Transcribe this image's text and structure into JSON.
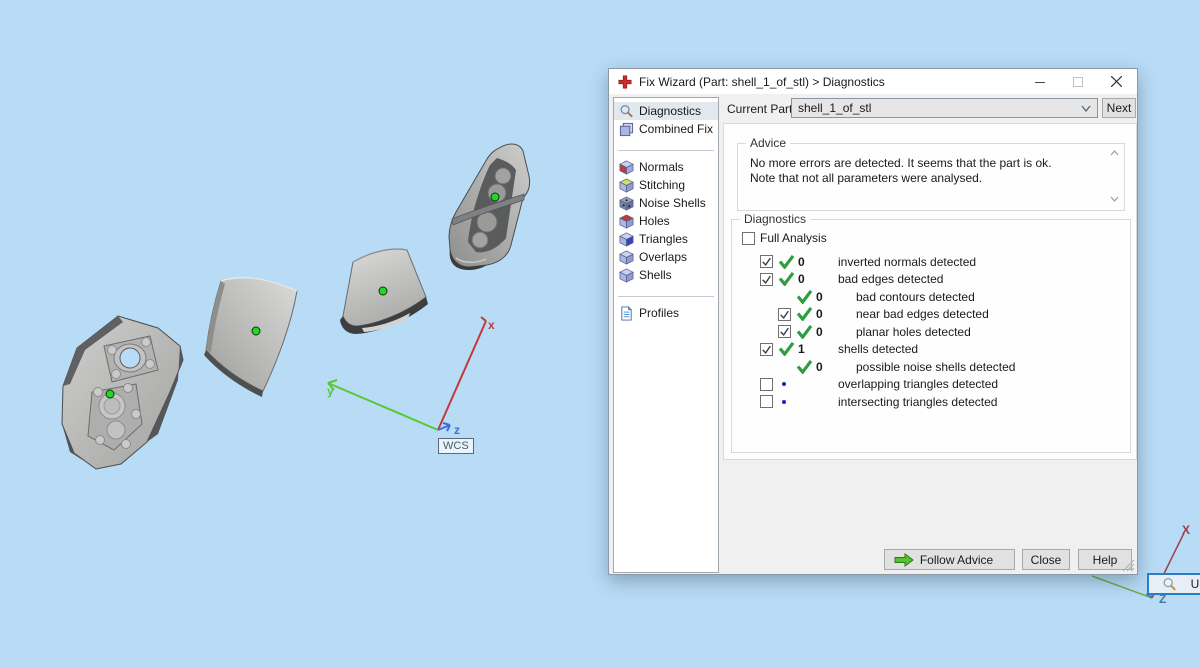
{
  "window": {
    "title": "Fix Wizard (Part: shell_1_of_stl) > Diagnostics",
    "app_icon": "red-cross-fix-wizard-icon",
    "controls": [
      "minimize",
      "maximize",
      "close"
    ]
  },
  "sidebar": {
    "sections": [
      {
        "items": [
          {
            "icon": "magnifier-icon",
            "label": "Diagnostics",
            "selected": true
          },
          {
            "icon": "combined-fix-cubes-icon",
            "label": "Combined Fix",
            "selected": false
          }
        ]
      },
      {
        "items": [
          {
            "icon": "cube-red-front-icon",
            "label": "Normals",
            "selected": false
          },
          {
            "icon": "cube-yellow-top-icon",
            "label": "Stitching",
            "selected": false
          },
          {
            "icon": "cube-dotted-icon",
            "label": "Noise Shells",
            "selected": false
          },
          {
            "icon": "cube-red-top-icon",
            "label": "Holes",
            "selected": false
          },
          {
            "icon": "cube-blue-face-icon",
            "label": "Triangles",
            "selected": false
          },
          {
            "icon": "cube-plain-icon",
            "label": "Overlaps",
            "selected": false
          },
          {
            "icon": "cube-plain-icon",
            "label": "Shells",
            "selected": false
          }
        ]
      },
      {
        "items": [
          {
            "icon": "document-icon",
            "label": "Profiles",
            "selected": false
          }
        ]
      }
    ]
  },
  "toolbar": {
    "current_part_label": "Current Part:",
    "current_part_value": "shell_1_of_stl",
    "next_button": "Next"
  },
  "advice": {
    "title": "Advice",
    "text": "No more errors are detected. It seems that the part is ok. Note that not all parameters were analysed."
  },
  "diagnostics": {
    "title": "Diagnostics",
    "full_analysis_label": "Full Analysis",
    "full_analysis_checked": false,
    "rows": [
      {
        "checkbox": true,
        "checked": true,
        "marker": "check",
        "count": "0",
        "label": "inverted normals detected",
        "indent": 0
      },
      {
        "checkbox": true,
        "checked": true,
        "marker": "check",
        "count": "0",
        "label": "bad edges detected",
        "indent": 0
      },
      {
        "checkbox": false,
        "checked": false,
        "marker": "check",
        "count": "0",
        "label": "bad contours detected",
        "indent": 1
      },
      {
        "checkbox": true,
        "checked": true,
        "marker": "check",
        "count": "0",
        "label": "near bad edges detected",
        "indent": 1
      },
      {
        "checkbox": true,
        "checked": true,
        "marker": "check",
        "count": "0",
        "label": "planar holes detected",
        "indent": 1
      },
      {
        "checkbox": true,
        "checked": true,
        "marker": "check",
        "count": "1",
        "label": "shells detected",
        "indent": 0
      },
      {
        "checkbox": false,
        "checked": false,
        "marker": "check",
        "count": "0",
        "label": "possible noise shells detected",
        "indent": 1
      },
      {
        "checkbox": true,
        "checked": false,
        "marker": "dot",
        "count": "",
        "label": "overlapping triangles detected",
        "indent": 0
      },
      {
        "checkbox": true,
        "checked": false,
        "marker": "dot",
        "count": "",
        "label": "intersecting triangles detected",
        "indent": 0
      }
    ],
    "update_button": "Update"
  },
  "footer": {
    "follow_advice_button": "Follow Advice",
    "close_button": "Close",
    "help_button": "Help"
  },
  "viewport": {
    "wcs_label": "WCS",
    "axes": {
      "x": "x",
      "y": "y",
      "z": "z"
    },
    "corner_axes": {
      "x": "X",
      "z": "Z"
    },
    "colors": {
      "background": "#b9dcf6",
      "axis_x": "#c03a3a",
      "axis_y": "#58c832",
      "axis_z": "#3a6fd8",
      "corner_axis_x": "#a03848",
      "corner_axis_z": "#4a6fa5",
      "shell_marker_green": "#27d42a",
      "check_green": "#2e9e3f",
      "dot_blue": "#2424c0",
      "update_focus_blue": "#2d7dc1"
    }
  }
}
